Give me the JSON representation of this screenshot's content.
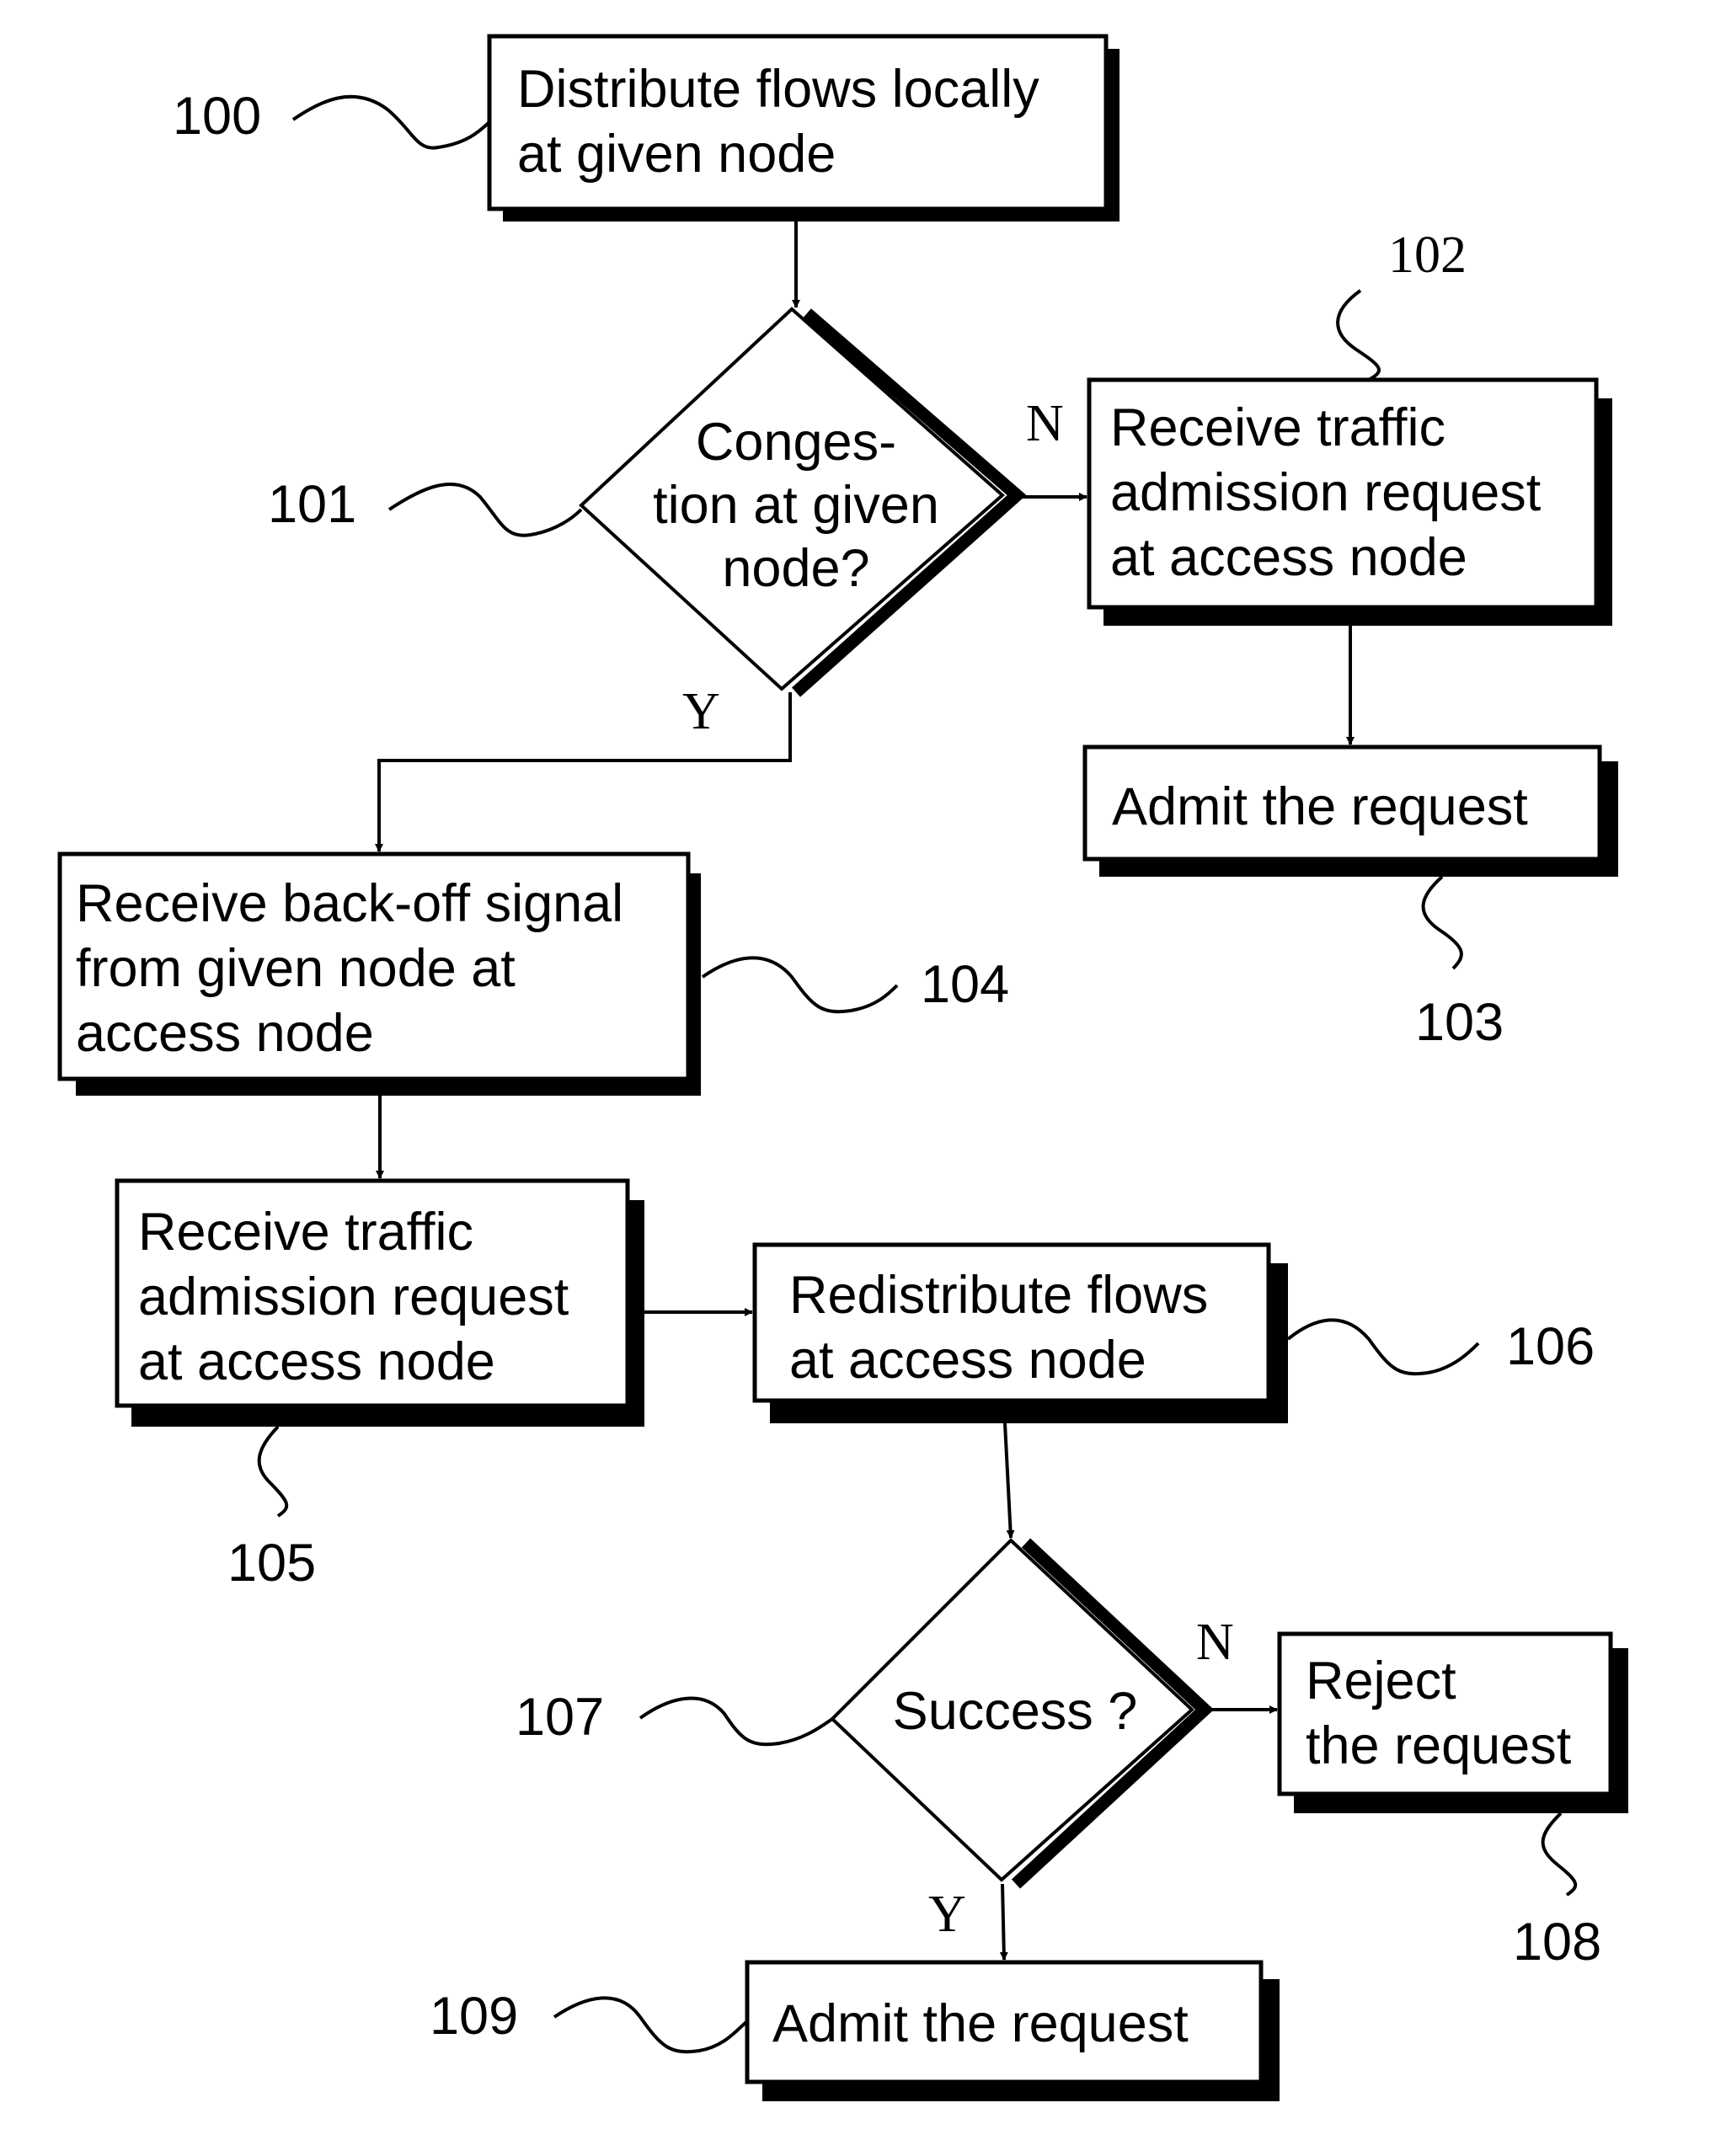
{
  "figure": {
    "type": "flowchart",
    "nodes": [
      {
        "id": "100",
        "ref": "100",
        "shape": "process",
        "text": "Distribute flows locally\nat given node"
      },
      {
        "id": "101",
        "ref": "101",
        "shape": "decision",
        "text": "Conges-\ntion at given\nnode?"
      },
      {
        "id": "102",
        "ref": "102",
        "shape": "process",
        "text": "Receive traffic\nadmission request\nat access node"
      },
      {
        "id": "103",
        "ref": "103",
        "shape": "process",
        "text": "Admit the request"
      },
      {
        "id": "104",
        "ref": "104",
        "shape": "process",
        "text": "Receive back-off signal\nfrom given node at\naccess node"
      },
      {
        "id": "105",
        "ref": "105",
        "shape": "process",
        "text": "Receive traffic\nadmission request\nat access node"
      },
      {
        "id": "106",
        "ref": "106",
        "shape": "process",
        "text": "Redistribute flows\nat access node"
      },
      {
        "id": "107",
        "ref": "107",
        "shape": "decision",
        "text": "Success ?"
      },
      {
        "id": "108",
        "ref": "108",
        "shape": "process",
        "text": "Reject\nthe request"
      },
      {
        "id": "109",
        "ref": "109",
        "shape": "process",
        "text": "Admit the request"
      }
    ],
    "edges": [
      {
        "from": "100",
        "to": "101",
        "label": ""
      },
      {
        "from": "101",
        "to": "102",
        "label": "N"
      },
      {
        "from": "101",
        "to": "104",
        "label": "Y"
      },
      {
        "from": "102",
        "to": "103",
        "label": ""
      },
      {
        "from": "104",
        "to": "105",
        "label": ""
      },
      {
        "from": "105",
        "to": "106",
        "label": ""
      },
      {
        "from": "106",
        "to": "107",
        "label": ""
      },
      {
        "from": "107",
        "to": "108",
        "label": "N"
      },
      {
        "from": "107",
        "to": "109",
        "label": "Y"
      }
    ],
    "branch_labels": {
      "yes": "Y",
      "no": "N"
    }
  }
}
